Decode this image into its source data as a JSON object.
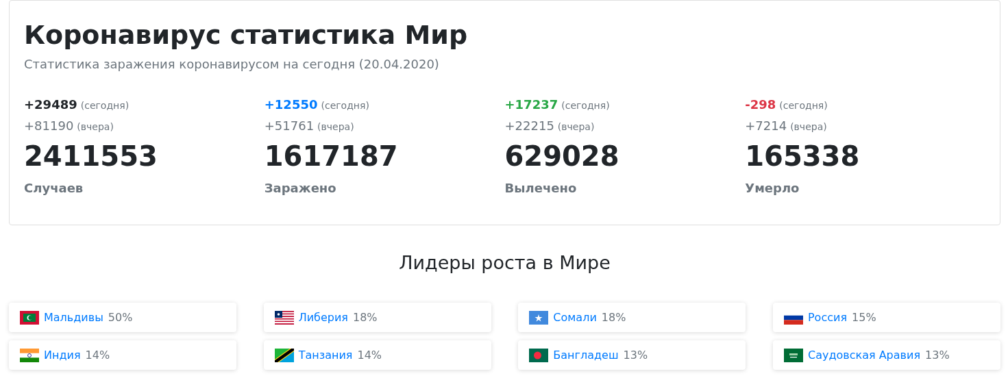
{
  "header": {
    "title": "Коронавирус статистика Мир",
    "subtitle": "Статистика заражения коронавирусом на сегодня (20.04.2020)"
  },
  "stats": [
    {
      "today": "+29489",
      "today_note": "(сегодня)",
      "yesterday": "+81190",
      "yesterday_note": "(вчера)",
      "total": "2411553",
      "label": "Случаев",
      "color": "#212529"
    },
    {
      "today": "+12550",
      "today_note": "(сегодня)",
      "yesterday": "+51761",
      "yesterday_note": "(вчера)",
      "total": "1617187",
      "label": "Заражено",
      "color": "#007bff"
    },
    {
      "today": "+17237",
      "today_note": "(сегодня)",
      "yesterday": "+22215",
      "yesterday_note": "(вчера)",
      "total": "629028",
      "label": "Вылечено",
      "color": "#28a745"
    },
    {
      "today": "-298",
      "today_note": "(сегодня)",
      "yesterday": "+7214",
      "yesterday_note": "(вчера)",
      "total": "165338",
      "label": "Умерло",
      "color": "#dc3545"
    }
  ],
  "leaders": {
    "title": "Лидеры роста в Мире",
    "items": [
      {
        "kind": "maldives",
        "country": "Мальдивы",
        "growth": "50%"
      },
      {
        "kind": "liberia",
        "country": "Либерия",
        "growth": "18%"
      },
      {
        "kind": "somalia",
        "country": "Сомали",
        "growth": "18%"
      },
      {
        "kind": "russia",
        "country": "Россия",
        "growth": "15%"
      },
      {
        "kind": "india",
        "country": "Индия",
        "growth": "14%"
      },
      {
        "kind": "tanzania",
        "country": "Танзания",
        "growth": "14%"
      },
      {
        "kind": "bangladesh",
        "country": "Бангладеш",
        "growth": "13%"
      },
      {
        "kind": "saudi",
        "country": "Саудовская Аравия",
        "growth": "13%"
      }
    ]
  }
}
